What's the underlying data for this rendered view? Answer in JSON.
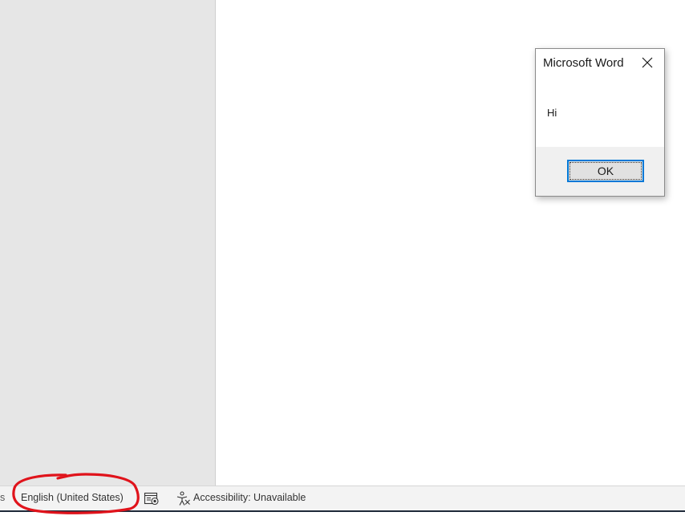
{
  "dialog": {
    "title": "Microsoft Word",
    "message": "Hi",
    "ok_label": "OK",
    "close_icon": "close-icon"
  },
  "status_bar": {
    "edge_text": "s",
    "language": "English (United States)",
    "focus_icon": "focus-mode-icon",
    "accessibility_icon": "accessibility-icon",
    "accessibility": "Accessibility: Unavailable"
  },
  "annotation": {
    "color": "#e0131b",
    "shape": "hand-drawn-circle"
  },
  "colors": {
    "nav_pane": "#e6e6e6",
    "dialog_footer": "#f0f0f0",
    "button_focus": "#0078d7",
    "status_bar": "#f3f3f3"
  }
}
